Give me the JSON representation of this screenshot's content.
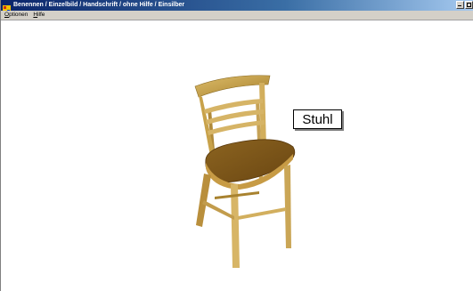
{
  "window": {
    "title": "Benennen / Einzelbild / Handschrift / ohne Hilfe / Einsilber"
  },
  "menu": {
    "items": [
      {
        "first": "O",
        "rest": "ptionen"
      },
      {
        "first": "H",
        "rest": "ilfe"
      }
    ]
  },
  "main": {
    "image_subject": "chair",
    "word": "Stuhl"
  },
  "colors": {
    "titlebar_start": "#0a246a",
    "titlebar_end": "#a6caf0",
    "chair_wood": "#c8a24a"
  }
}
